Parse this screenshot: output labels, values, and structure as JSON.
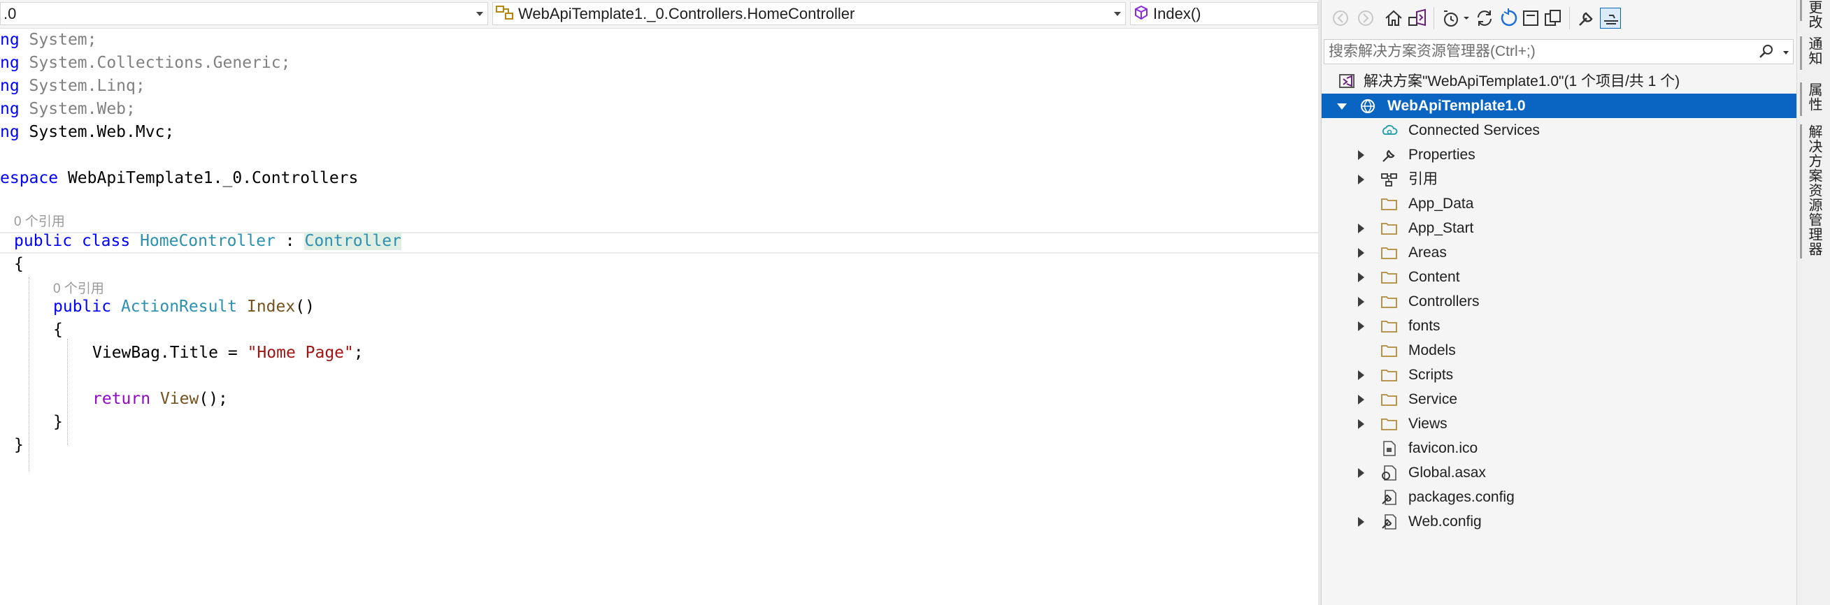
{
  "nav": {
    "project_dropdown": ".0",
    "class_dropdown": "WebApiTemplate1._0.Controllers.HomeController",
    "member_dropdown": "Index()"
  },
  "code": {
    "lines": [
      {
        "a": "ng",
        "b": " System;"
      },
      {
        "a": "ng",
        "b": " System.Collections.Generic;"
      },
      {
        "a": "ng",
        "b": " System.Linq;"
      },
      {
        "a": "ng",
        "b": " System.Web;"
      },
      {
        "a": "ng",
        "b": " System.Web.Mvc;"
      }
    ],
    "ns_kw": "espace",
    "ns_name": " WebApiTemplate1._0.Controllers",
    "lens_class": "0 个引用",
    "class_public": "public",
    "class_kw": "class",
    "class_name": "HomeController",
    "class_colon": " : ",
    "class_base": "Controller",
    "brace_open": "{",
    "lens_method": "0 个引用",
    "method_public": "public",
    "method_type": "ActionResult",
    "method_name": "Index",
    "method_parens": "()",
    "mbrace_open": "{",
    "viewbag": "ViewBag.Title = ",
    "viewbag_str": "\"Home Page\"",
    "viewbag_end": ";",
    "return_kw": "return",
    "return_call": "View",
    "return_end": "();",
    "mbrace_close": "}",
    "brace_close": "}"
  },
  "solution_explorer": {
    "search_placeholder": "搜索解决方案资源管理器(Ctrl+;)",
    "solution_label": "解决方案\"WebApiTemplate1.0\"(1 个项目/共 1 个)",
    "project_label": "WebApiTemplate1.0",
    "items": [
      {
        "label": "Connected Services",
        "expandable": false,
        "icon": "connected-services-icon"
      },
      {
        "label": "Properties",
        "expandable": true,
        "icon": "wrench-icon"
      },
      {
        "label": "引用",
        "expandable": true,
        "icon": "references-icon"
      },
      {
        "label": "App_Data",
        "expandable": false,
        "icon": "folder-icon"
      },
      {
        "label": "App_Start",
        "expandable": true,
        "icon": "folder-icon"
      },
      {
        "label": "Areas",
        "expandable": true,
        "icon": "folder-icon"
      },
      {
        "label": "Content",
        "expandable": true,
        "icon": "folder-icon"
      },
      {
        "label": "Controllers",
        "expandable": true,
        "icon": "folder-icon"
      },
      {
        "label": "fonts",
        "expandable": true,
        "icon": "folder-icon"
      },
      {
        "label": "Models",
        "expandable": false,
        "icon": "folder-icon"
      },
      {
        "label": "Scripts",
        "expandable": true,
        "icon": "folder-icon"
      },
      {
        "label": "Service",
        "expandable": true,
        "icon": "folder-icon"
      },
      {
        "label": "Views",
        "expandable": true,
        "icon": "folder-icon"
      },
      {
        "label": "favicon.ico",
        "expandable": false,
        "icon": "image-file-icon"
      },
      {
        "label": "Global.asax",
        "expandable": true,
        "icon": "asax-file-icon"
      },
      {
        "label": "packages.config",
        "expandable": false,
        "icon": "config-file-icon"
      },
      {
        "label": "Web.config",
        "expandable": true,
        "icon": "config-file-icon"
      }
    ]
  },
  "side_tabs": {
    "tab1": "更改",
    "tab2": "通知",
    "tab3": "属性",
    "tab4": "解决方案资源管理器"
  },
  "colors": {
    "selection": "#0a64c1",
    "keyword": "#0000ff",
    "type": "#2b91af",
    "string": "#a31515"
  }
}
